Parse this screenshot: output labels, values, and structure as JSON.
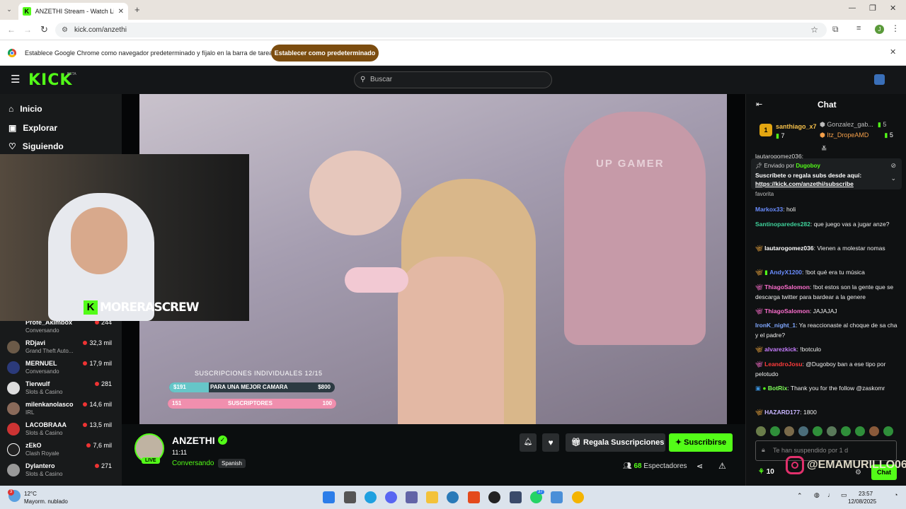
{
  "browser": {
    "tab_title": "ANZETHI Stream - Watch Li",
    "url": "kick.com/anzethi",
    "profile_letter": "J",
    "infobar_text": "Establece Google Chrome como navegador predeterminado y fíjalo en la barra de tareas",
    "infobar_button": "Establecer como predeterminado"
  },
  "kick": {
    "logo": "KICK",
    "beta": "BETA",
    "search_placeholder": "Buscar",
    "nav": [
      {
        "label": "Inicio",
        "icon": "home-icon"
      },
      {
        "label": "Explorar",
        "icon": "compass-icon"
      },
      {
        "label": "Siguiendo",
        "icon": "heart-icon"
      }
    ],
    "webcam_overlay": "MORERASCREW",
    "channels": [
      {
        "name": "Profe_Akimbox",
        "game": "Conversando",
        "viewers": "244"
      },
      {
        "name": "RDjavi",
        "game": "Grand Theft Auto...",
        "viewers": "32,3 mil"
      },
      {
        "name": "MERNUEL",
        "game": "Conversando",
        "viewers": "17,9 mil"
      },
      {
        "name": "Tierwulf",
        "game": "Slots & Casino",
        "viewers": "281"
      },
      {
        "name": "milenkanolasco",
        "game": "IRL",
        "viewers": "14,6 mil"
      },
      {
        "name": "LACOBRAAA",
        "game": "Slots & Casino",
        "viewers": "13,5 mil"
      },
      {
        "name": "zEkO",
        "game": "Clash Royale",
        "viewers": "7,6 mil"
      },
      {
        "name": "Dylantero",
        "game": "Slots & Casino",
        "viewers": "271"
      }
    ]
  },
  "video": {
    "goal_title": "SUSCRIPCIONES INDIVIDUALES 12/15",
    "goal1": {
      "left": "$191",
      "label": "PARA UNA MEJOR CAMARA",
      "right": "$800",
      "progress": 0.24
    },
    "goal2": {
      "left": "151",
      "label": "SUSCRIPTORES",
      "right": "100",
      "progress": 1.0
    },
    "chair_text": "UP GAMER"
  },
  "stream": {
    "name": "ANZETHI",
    "uptime": "11:11",
    "category": "Conversando",
    "language": "Spanish",
    "live": "LIVE",
    "gift_button": "Regala Suscripciones",
    "subscribe_button": "Suscribirse",
    "viewers": "68",
    "viewers_label": "Espectadores"
  },
  "chat": {
    "title": "Chat",
    "leaders": [
      {
        "rank": "1",
        "name": "santhiago_x7",
        "count": "7"
      },
      {
        "name": "Gonzalez_gab...",
        "count": "5"
      },
      {
        "name": "Itz_DropeAMD",
        "count": "5"
      }
    ],
    "pinned": {
      "by_label": "Enviado por",
      "by_user": "Dugoboy",
      "text": "Suscríbete o regala subs desde aquí:",
      "link": "https://kick.com/anzethi/subscribe"
    },
    "partial_top": "lautarogomez036:",
    "partial_line": "favorita",
    "messages": [
      {
        "user": "Markox33",
        "color": "#6a8dff",
        "text": "holi"
      },
      {
        "user": "Santinoparedes282",
        "color": "#3fd29b",
        "text": "que juego vas a jugar anze?"
      },
      {
        "user": "lautarogomez036",
        "color": "#ffffff",
        "text": "Vienen a molestar nomas"
      },
      {
        "user": "AndyX1200",
        "color": "#6a8dff",
        "text": "!bot qué era tu música"
      },
      {
        "user": "ThiagoSalomon",
        "color": "#ff6fcf",
        "text": "!bot estos son la gente que se descarga twitter para bardear a la genere"
      },
      {
        "user": "ThiagoSalomon",
        "color": "#ff6fcf",
        "text": "JAJAJAJ"
      },
      {
        "user": "IronK_night_1",
        "color": "#7fa7ff",
        "text": "Ya reaccionaste al choque de sa cha y el padre?"
      },
      {
        "user": "alvarezkick",
        "color": "#c77dff",
        "text": "!botculo"
      },
      {
        "user": "LeandroJosu",
        "color": "#ff3b3b",
        "text": "@Dugoboy ban a ese tipo por pelotudo"
      },
      {
        "user": "BotRix",
        "color": "#7fff5a",
        "text": "Thank you for the follow @zaskomr"
      },
      {
        "user": "HAZARD177",
        "color": "#c8b5ff",
        "text": "1800"
      }
    ],
    "input_placeholder": "Te han suspendido por 1 d",
    "points": "10",
    "chat_button": "Chat",
    "watermark": "@EMAMURILLO06"
  },
  "taskbar": {
    "temp": "12°C",
    "weather": "Mayorm. nublado",
    "badge": "3",
    "time": "23:57",
    "date": "12/08/2025",
    "wa_badge": "37"
  }
}
